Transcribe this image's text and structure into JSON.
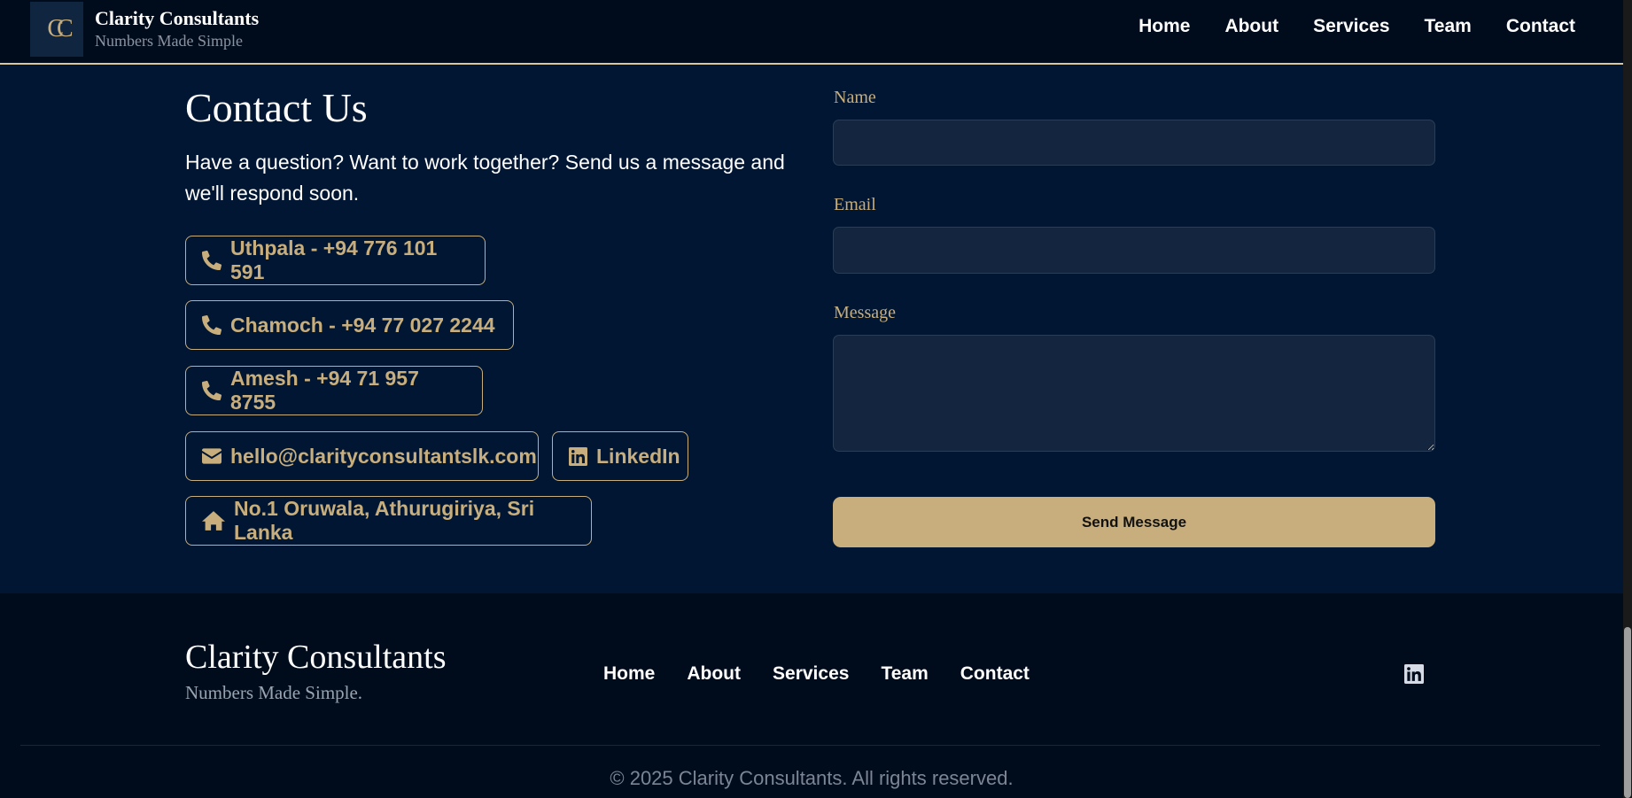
{
  "header": {
    "logo_initials": "CC",
    "brand_name": "Clarity Consultants",
    "brand_tagline": "Numbers Made Simple",
    "nav": [
      "Home",
      "About",
      "Services",
      "Team",
      "Contact"
    ]
  },
  "contact": {
    "title": "Contact Us",
    "intro": "Have a question? Want to work together? Send us a message and we'll respond soon.",
    "phones": [
      {
        "label": "Uthpala - +94 776 101 591",
        "icon": "phone-icon"
      },
      {
        "label": "Chamoch - +94 77 027 2244",
        "icon": "phone-icon"
      },
      {
        "label": "Amesh - +94 71 957 8755",
        "icon": "phone-icon"
      }
    ],
    "email": {
      "label": "hello@clarityconsultantslk.com",
      "icon": "envelope-icon"
    },
    "linkedin": {
      "label": "LinkedIn",
      "icon": "linkedin-icon"
    },
    "address": {
      "label": "No.1 Oruwala, Athurugiriya, Sri Lanka",
      "icon": "home-icon"
    }
  },
  "form": {
    "name_label": "Name",
    "name_value": "",
    "email_label": "Email",
    "email_value": "",
    "message_label": "Message",
    "message_value": "",
    "submit_label": "Send Message"
  },
  "footer": {
    "brand_name": "Clarity Consultants",
    "tagline": "Numbers Made Simple.",
    "nav": [
      "Home",
      "About",
      "Services",
      "Team",
      "Contact"
    ],
    "social_icon": "linkedin-icon",
    "copyright": "© 2025 Clarity Consultants. All rights reserved."
  },
  "colors": {
    "page_bg": "#001633",
    "header_bg": "#000c1c",
    "accent_gold": "#c8ae7c",
    "field_bg": "#14263f"
  }
}
